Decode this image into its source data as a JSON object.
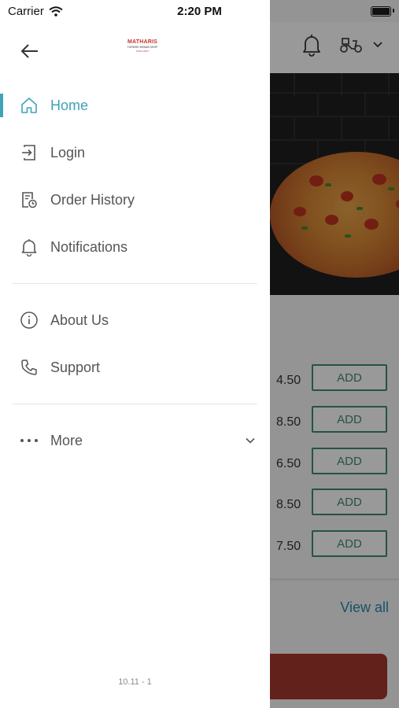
{
  "status_bar": {
    "carrier": "Carrier",
    "time": "2:20 PM"
  },
  "logo": {
    "name": "MATHARIS",
    "subtitle": "TURKISH KEBAB SHOP",
    "tagline": "TAKE AWAY"
  },
  "menu": {
    "primary": [
      {
        "label": "Home",
        "icon": "home-icon",
        "active": true
      },
      {
        "label": "Login",
        "icon": "login-icon",
        "active": false
      },
      {
        "label": "Order History",
        "icon": "order-history-icon",
        "active": false
      },
      {
        "label": "Notifications",
        "icon": "bell-icon",
        "active": false
      }
    ],
    "secondary": [
      {
        "label": "About Us",
        "icon": "info-icon"
      },
      {
        "label": "Support",
        "icon": "phone-icon"
      }
    ],
    "more": {
      "label": "More",
      "icon": "more-dots-icon"
    }
  },
  "version": "10.11 - 1",
  "background": {
    "items": [
      {
        "price": "4.50",
        "button": "ADD"
      },
      {
        "price": "8.50",
        "button": "ADD"
      },
      {
        "price": "6.50",
        "button": "ADD"
      },
      {
        "price": "8.50",
        "button": "ADD"
      },
      {
        "price": "7.50",
        "button": "ADD"
      }
    ],
    "view_all": "View all"
  },
  "colors": {
    "accent": "#3ea3b8",
    "add_button": "#3f8b6b",
    "cart_bar": "#a3382c"
  }
}
